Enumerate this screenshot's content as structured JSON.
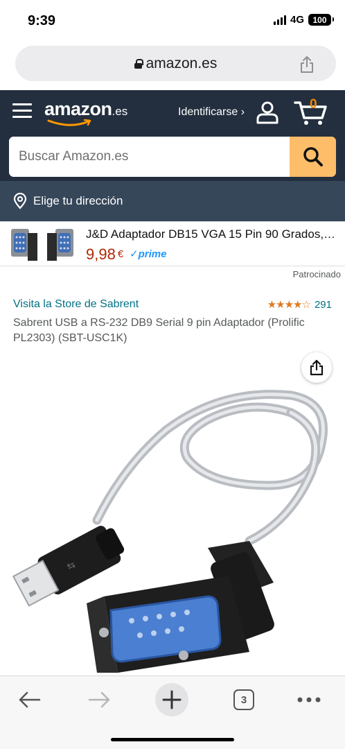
{
  "status": {
    "time": "9:39",
    "network": "4G",
    "battery": "100"
  },
  "browser": {
    "url": "amazon.es",
    "tab_count": "3"
  },
  "header": {
    "logo": "amazon",
    "logo_suffix": ".es",
    "signin_label": "Identificarse ›",
    "cart_count": "0",
    "search_placeholder": "Buscar Amazon.es",
    "location_label": "Elige tu dirección"
  },
  "sponsored": {
    "title": "J&D Adaptador DB15 VGA 15 Pin 90 Grados,…",
    "price": "9,98",
    "currency": "€",
    "prime_label": "✓prime",
    "sponsored_label": "Patrocinado"
  },
  "product": {
    "store_link": "Visita la Store de Sabrent",
    "rating": 4.5,
    "stars_text": "★★★★☆",
    "rating_count": "291",
    "title": "Sabrent USB a RS-232 DB9 Serial 9 pin Adaptador (Prolific PL2303) (SBT-USC1K)"
  },
  "colors": {
    "header_bg": "#232f3e",
    "location_bg": "#37475a",
    "search_button": "#febd69",
    "link": "#007185",
    "price": "#b12704",
    "star": "#de7921",
    "prime": "#1a98ff"
  },
  "icons": {
    "menu": "hamburger-icon",
    "user": "user-icon",
    "cart": "cart-icon",
    "search": "search-icon",
    "location": "location-pin-icon",
    "share": "share-icon",
    "back": "back-arrow-icon",
    "forward": "forward-arrow-icon",
    "new_tab": "plus-icon",
    "tabs": "tabs-icon",
    "more": "more-icon"
  }
}
